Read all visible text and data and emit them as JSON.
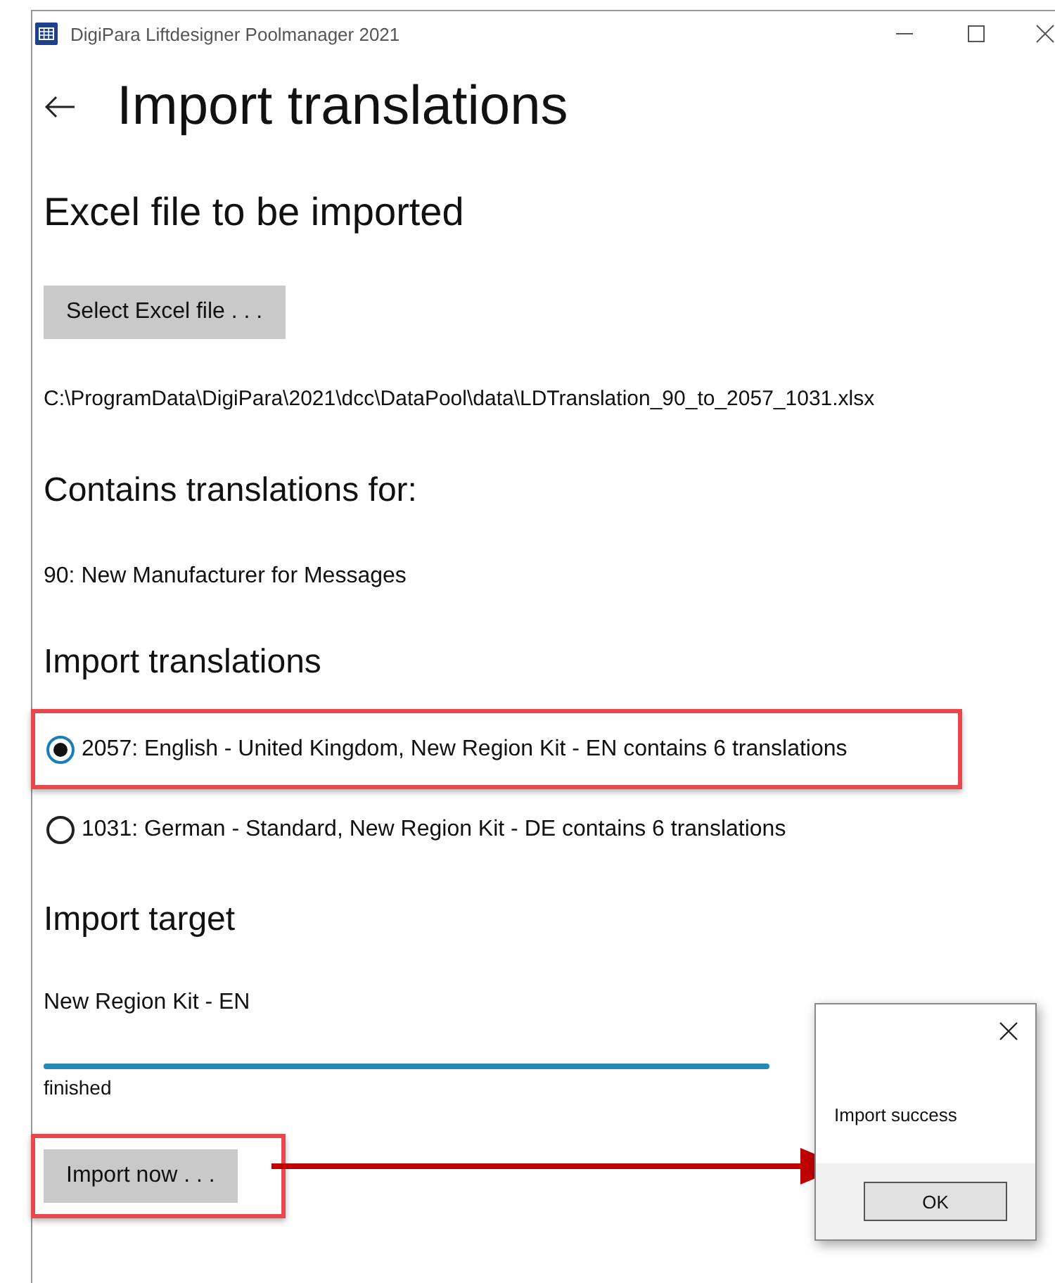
{
  "window": {
    "title": "DigiPara Liftdesigner Poolmanager 2021"
  },
  "page": {
    "title": "Import translations"
  },
  "excel_section": {
    "heading": "Excel file to be imported",
    "button": "Select Excel file . . .",
    "file_path": "C:\\ProgramData\\DigiPara\\2021\\dcc\\DataPool\\data\\LDTranslation_90_to_2057_1031.xlsx"
  },
  "contains_section": {
    "heading": "Contains translations for:",
    "items": [
      "90: New Manufacturer for Messages"
    ]
  },
  "import_section": {
    "heading": "Import translations",
    "options": [
      {
        "label": "2057: English - United Kingdom, New Region Kit - EN contains 6 translations",
        "selected": true,
        "highlighted": true
      },
      {
        "label": "1031: German - Standard, New Region Kit - DE contains 6 translations",
        "selected": false,
        "highlighted": false
      }
    ]
  },
  "target_section": {
    "heading": "Import target",
    "target": "New Region Kit - EN",
    "progress": {
      "level": 1,
      "status": "finished"
    },
    "button": "Import now . . .",
    "button_highlighted": true
  },
  "dialog": {
    "message": "Import success",
    "button": "OK"
  }
}
